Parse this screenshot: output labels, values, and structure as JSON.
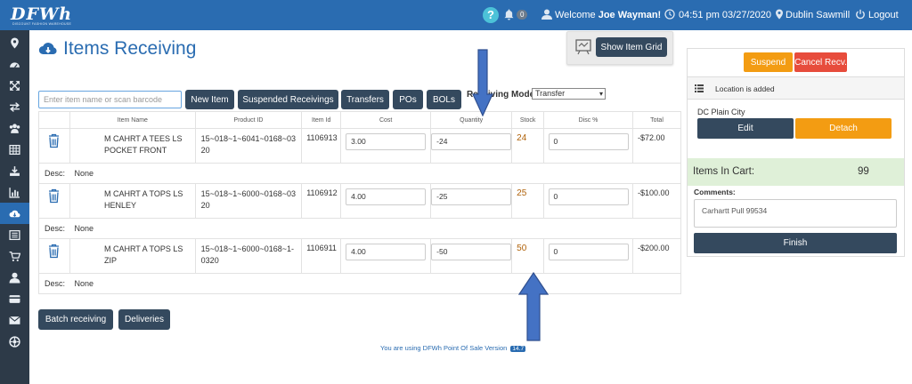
{
  "header": {
    "logo": "DFWh",
    "logo_sub": "DISCOUNT FASHION WAREHOUSE",
    "help": "?",
    "notif_count": "0",
    "welcome_prefix": "Welcome",
    "user": "Joe Wayman!",
    "datetime": "04:51 pm 03/27/2020",
    "location": "Dublin Sawmill",
    "logout": "Logout"
  },
  "page": {
    "title": "Items Receiving",
    "show_grid_label": "Show Item Grid"
  },
  "toolbar": {
    "search_placeholder": "Enter item name or scan barcode",
    "new_item": "New Item",
    "suspended": "Suspended Receivings",
    "transfers": "Transfers",
    "pos": "POs",
    "bols": "BOLs",
    "receiving_mode_label": "Receiving Mode",
    "receiving_mode_value": "Transfer"
  },
  "table": {
    "headers": [
      "Item Name",
      "Product ID",
      "Item Id",
      "Cost",
      "Quantity",
      "Stock",
      "Disc %",
      "Total"
    ],
    "desc_label": "Desc:",
    "rows": [
      {
        "name": "M CAHRT A TEES LS POCKET FRONT",
        "product_id": "15~018~1~6041~0168~0320",
        "item_id": "1106913",
        "cost": "3.00",
        "quantity": "-24",
        "stock": "24",
        "disc": "0",
        "total": "-$72.00",
        "desc": "None"
      },
      {
        "name": "M CAHRT A TOPS LS HENLEY",
        "product_id": "15~018~1~6000~0168~0320",
        "item_id": "1106912",
        "cost": "4.00",
        "quantity": "-25",
        "stock": "25",
        "disc": "0",
        "total": "-$100.00",
        "desc": "None"
      },
      {
        "name": "M CAHRT A TOPS LS ZIP",
        "product_id": "15~018~1~6000~0168~1-0320",
        "item_id": "1106911",
        "cost": "4.00",
        "quantity": "-50",
        "stock": "50",
        "disc": "0",
        "total": "-$200.00",
        "desc": "None"
      }
    ]
  },
  "bottom": {
    "batch": "Batch receiving",
    "deliveries": "Deliveries",
    "footer_text": "You are using DFWh Point Of Sale Version",
    "version": "14.7"
  },
  "side_panel": {
    "suspend": "Suspend",
    "cancel": "Cancel Recv.",
    "location_msg": "Location is added",
    "location_name": "DC Plain City",
    "edit": "Edit",
    "detach": "Detach",
    "items_in_cart_label": "Items In Cart:",
    "items_in_cart_value": "99",
    "comments_label": "Comments:",
    "comments_value": "Carhartt Pull 99534",
    "finish": "Finish"
  },
  "colors": {
    "brand": "#2a6cb1",
    "dark": "#34495e",
    "orange": "#f39c12",
    "red": "#e74c3c",
    "stock": "#b0620a"
  },
  "sidebar": {
    "icons": [
      "map-marker-icon",
      "dashboard-icon",
      "expand-icon",
      "exchange-icon",
      "users-icon",
      "table-icon",
      "download-icon",
      "bar-chart-icon",
      "cloud-download-icon",
      "list-icon",
      "cart-icon",
      "user-icon",
      "credit-card-icon",
      "envelope-icon",
      "empire-icon"
    ]
  }
}
